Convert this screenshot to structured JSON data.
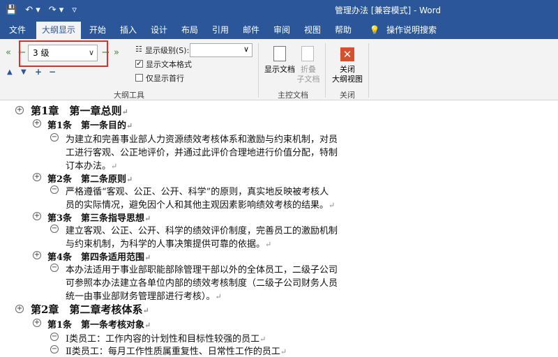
{
  "titlebar": {
    "title": "管理办法 [兼容模式] - Word"
  },
  "tabs": [
    "文件",
    "大纲显示",
    "开始",
    "插入",
    "设计",
    "布局",
    "引用",
    "邮件",
    "审阅",
    "视图",
    "帮助",
    "操作说明搜索"
  ],
  "ribbon": {
    "level_value": "3 级",
    "show_level_label": "显示级别(S):",
    "show_text_format": "显示文本格式",
    "show_first_line": "仅显示首行",
    "outline_tools_label": "大纲工具",
    "show_doc_label": "显示文档",
    "collapse_sub_label": "折叠",
    "collapse_sub_label2": "子文档",
    "master_doc_group": "主控文档",
    "close_outline_label": "关闭",
    "close_outline_label2": "大纲视图",
    "close_group": "关闭"
  },
  "doc": {
    "l1": "第1章　第一章总则",
    "l2": "第1条　第一条目的",
    "l3": "为建立和完善事业部人力资源绩效考核体系和激励与约束机制，对员",
    "l4": "工进行客观、公正地评价，并通过此评价合理地进行价值分配，特制",
    "l5": "订本办法。",
    "l6": "第2条　第二条原则",
    "l7": "严格遵循“客观、公正、公开、科学”的原则，真实地反映被考核人",
    "l8": "员的实际情况，避免因个人和其他主观因素影响绩效考核的结果。",
    "l9": "第3条　第三条指导思想",
    "l10": "建立客观、公正、公开、科学的绩效评价制度，完善员工的激励机制",
    "l11": "与约束机制，为科学的人事决策提供可靠的依据。",
    "l12": "第4条　第四条适用范围",
    "l13": "本办法适用于事业部职能部除管理干部以外的全体员工，二级子公司",
    "l14": "可参照本办法建立各单位内部的绩效考核制度（二级子公司财务人员",
    "l15": "统一由事业部财务管理部进行考核）。",
    "l16": "第2章　第二章考核体系",
    "l17": "第1条　第一条考核对象",
    "l18": "Ⅰ类员工：工作内容的计划性和目标性较强的员工",
    "l19": "Ⅱ类员工：每月工作性质属重复性、日常性工作的员工"
  }
}
